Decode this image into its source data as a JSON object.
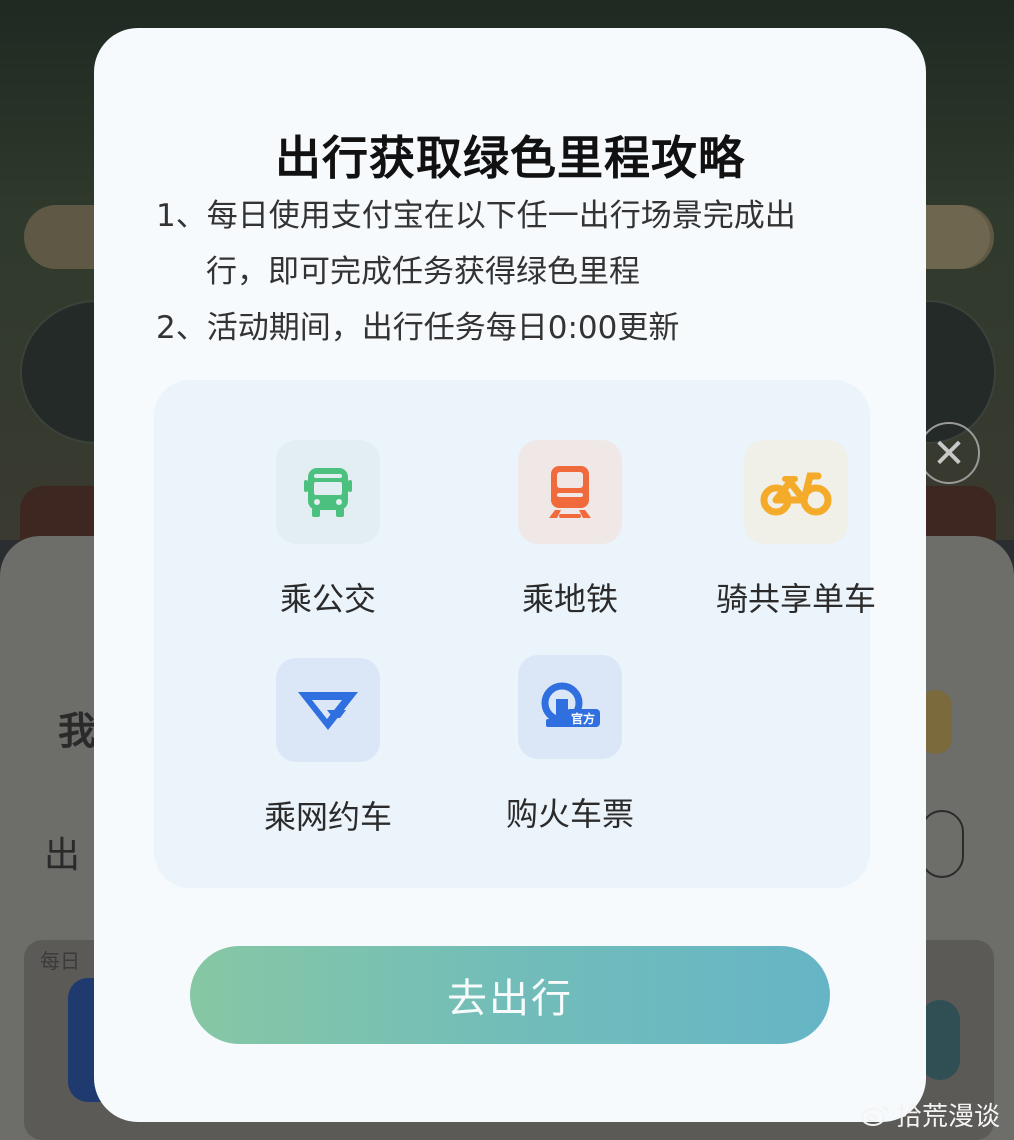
{
  "background": {
    "section_title_partial": "我",
    "row_label_partial": "出",
    "daily_label_partial": "每日",
    "close_symbol": "✕"
  },
  "modal": {
    "title": "出行获取绿色里程攻略",
    "rules": {
      "rule1_line1": "1、每日使用支付宝在以下任一出行场景完成出",
      "rule1_line2": "行，即可完成任务获得绿色里程",
      "rule2": "2、活动期间，出行任务每日0:00更新"
    },
    "scenes": [
      {
        "label": "乘公交",
        "icon": "bus-icon",
        "color": "#4cc07f"
      },
      {
        "label": "乘地铁",
        "icon": "metro-icon",
        "color": "#f06a3c"
      },
      {
        "label": "骑共享单车",
        "icon": "bike-icon",
        "color": "#f5ab2a"
      },
      {
        "label": "乘网约车",
        "icon": "ride-hailing-icon",
        "color": "#2f6fe0"
      },
      {
        "label": "购火车票",
        "icon": "train-ticket-icon",
        "color": "#2f6fe0",
        "badge": "官方"
      }
    ],
    "go_button_label": "去出行"
  },
  "watermark": {
    "text": "拾荒漫谈"
  }
}
